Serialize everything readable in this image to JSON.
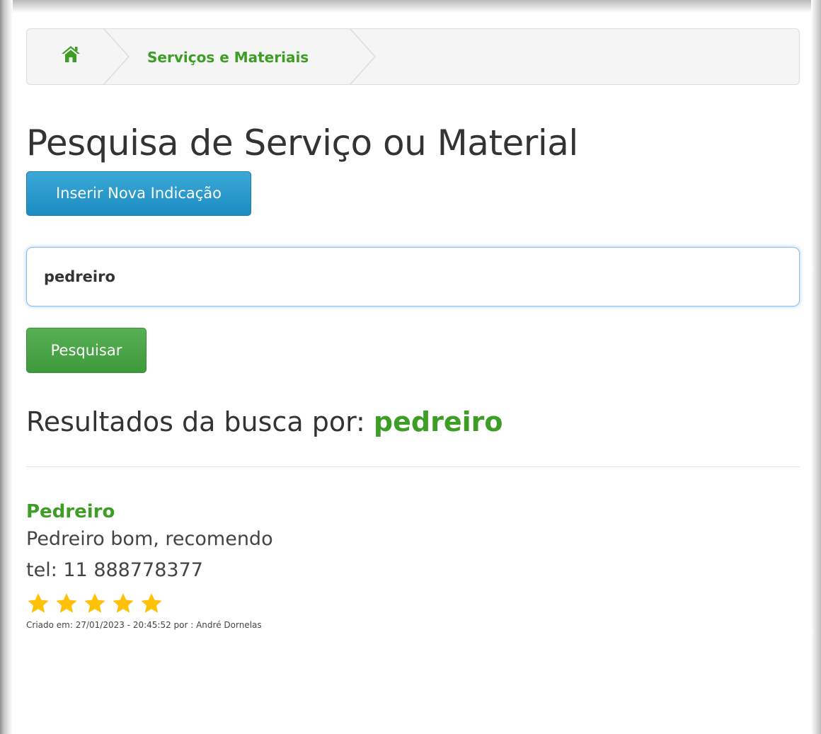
{
  "breadcrumb": {
    "home_icon": "home-icon",
    "section_label": "Serviços e Materiais"
  },
  "page": {
    "title": "Pesquisa de Serviço ou Material"
  },
  "actions": {
    "new_indication_label": "Inserir Nova Indicação",
    "search_label": "Pesquisar"
  },
  "search": {
    "value": "pedreiro",
    "placeholder": ""
  },
  "results": {
    "heading_prefix": "Resultados da busca por:",
    "term": "pedreiro",
    "items": [
      {
        "title": "Pedreiro",
        "description": "Pedreiro bom, recomendo",
        "phone": "tel: 11 888778377",
        "rating": 5,
        "rating_max": 5,
        "meta": "Criado em: 27/01/2023 - 20:45:52 por : André Dornelas"
      }
    ]
  },
  "colors": {
    "accent_green": "#3d9d24",
    "primary_blue": "#1c8cc2",
    "success_green": "#3e9a3b",
    "star_gold": "#ffc107"
  }
}
